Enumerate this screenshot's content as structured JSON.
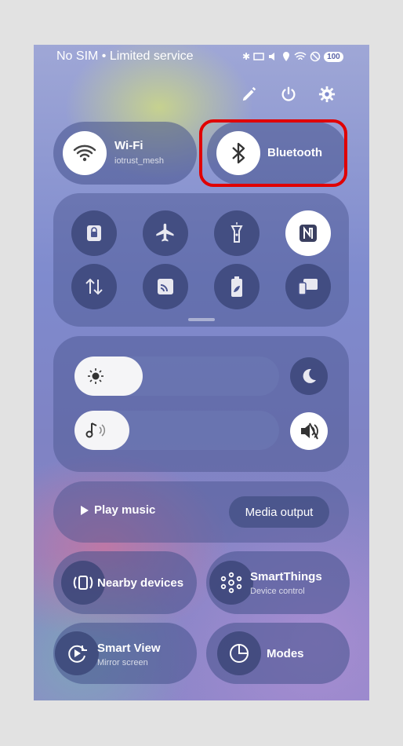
{
  "status_bar": {
    "carrier": "No SIM • Limited service",
    "battery": "100"
  },
  "header": {
    "edit_icon": "pencil-icon",
    "power_icon": "power-icon",
    "settings_icon": "gear-icon"
  },
  "quick_tiles": {
    "wifi": {
      "label": "Wi-Fi",
      "sub": "iotrust_mesh"
    },
    "bluetooth": {
      "label": "Bluetooth"
    }
  },
  "toggles": [
    "lock-icon",
    "airplane-icon",
    "flashlight-icon",
    "nfc-icon",
    "data-transfer-icon",
    "cast-icon",
    "battery-saver-icon",
    "dex-icon"
  ],
  "sliders": {
    "brightness_level": 0.3,
    "volume_level": 0.25
  },
  "media": {
    "play": "Play music",
    "output": "Media output"
  },
  "bottom_tiles": {
    "nearby": {
      "label": "Nearby devices"
    },
    "smartthings": {
      "label": "SmartThings",
      "sub": "Device control"
    },
    "smartview": {
      "label": "Smart View",
      "sub": "Mirror screen"
    },
    "modes": {
      "label": "Modes"
    }
  }
}
